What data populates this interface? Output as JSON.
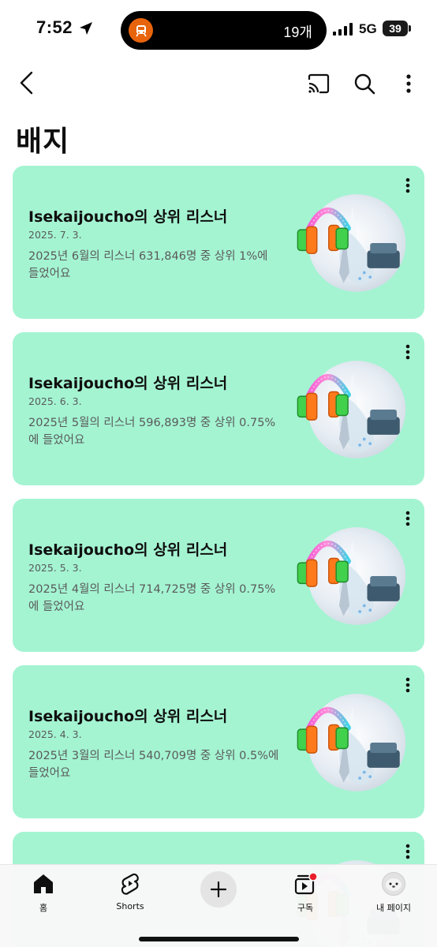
{
  "status_bar": {
    "time": "7:52",
    "island_count": "19개",
    "network": "5G",
    "battery": "39"
  },
  "header": {
    "title": "배지"
  },
  "badges": [
    {
      "title": "Isekaijoucho의 상위 리스너",
      "date": "2025. 7. 3.",
      "description": "2025년 6월의 리스너 631,846명 중 상위 1%에 들었어요"
    },
    {
      "title": "Isekaijoucho의 상위 리스너",
      "date": "2025. 6. 3.",
      "description": "2025년 5월의 리스너 596,893명 중 상위 0.75%에 들었어요"
    },
    {
      "title": "Isekaijoucho의 상위 리스너",
      "date": "2025. 5. 3.",
      "description": "2025년 4월의 리스너 714,725명 중 상위 0.75%에 들었어요"
    },
    {
      "title": "Isekaijoucho의 상위 리스너",
      "date": "2025. 4. 3.",
      "description": "2025년 3월의 리스너 540,709명 중 상위 0.5%에 들었어요"
    }
  ],
  "bottom_nav": {
    "home": "홈",
    "shorts": "Shorts",
    "subscriptions": "구독",
    "my_page": "내 페이지"
  },
  "colors": {
    "card_background": "#a4f4d2",
    "notification_dot": "#e91e2b",
    "train_icon_bg": "#e8640c"
  }
}
